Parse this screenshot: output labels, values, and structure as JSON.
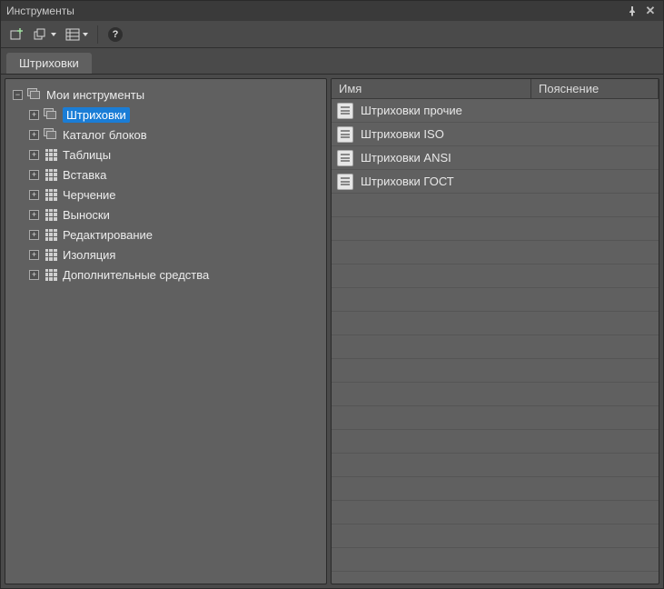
{
  "title": "Инструменты",
  "tab_label": "Штриховки",
  "tree": {
    "root": {
      "label": "Мои инструменты",
      "expanded": true
    },
    "items": [
      {
        "label": "Штриховки",
        "icon": "stack",
        "selected": true
      },
      {
        "label": "Каталог блоков",
        "icon": "stack",
        "selected": false
      },
      {
        "label": "Таблицы",
        "icon": "grid",
        "selected": false
      },
      {
        "label": "Вставка",
        "icon": "grid",
        "selected": false
      },
      {
        "label": "Черчение",
        "icon": "grid",
        "selected": false
      },
      {
        "label": "Выноски",
        "icon": "grid",
        "selected": false
      },
      {
        "label": "Редактирование",
        "icon": "grid",
        "selected": false
      },
      {
        "label": "Изоляция",
        "icon": "grid",
        "selected": false
      },
      {
        "label": "Дополнительные средства",
        "icon": "grid",
        "selected": false
      }
    ]
  },
  "list": {
    "columns": {
      "name": "Имя",
      "desc": "Пояснение"
    },
    "rows": [
      {
        "name": "Штриховки прочие",
        "desc": ""
      },
      {
        "name": "Штриховки ISO",
        "desc": ""
      },
      {
        "name": "Штриховки ANSI",
        "desc": ""
      },
      {
        "name": "Штриховки ГОСТ",
        "desc": ""
      }
    ],
    "empty_row_count": 17
  }
}
